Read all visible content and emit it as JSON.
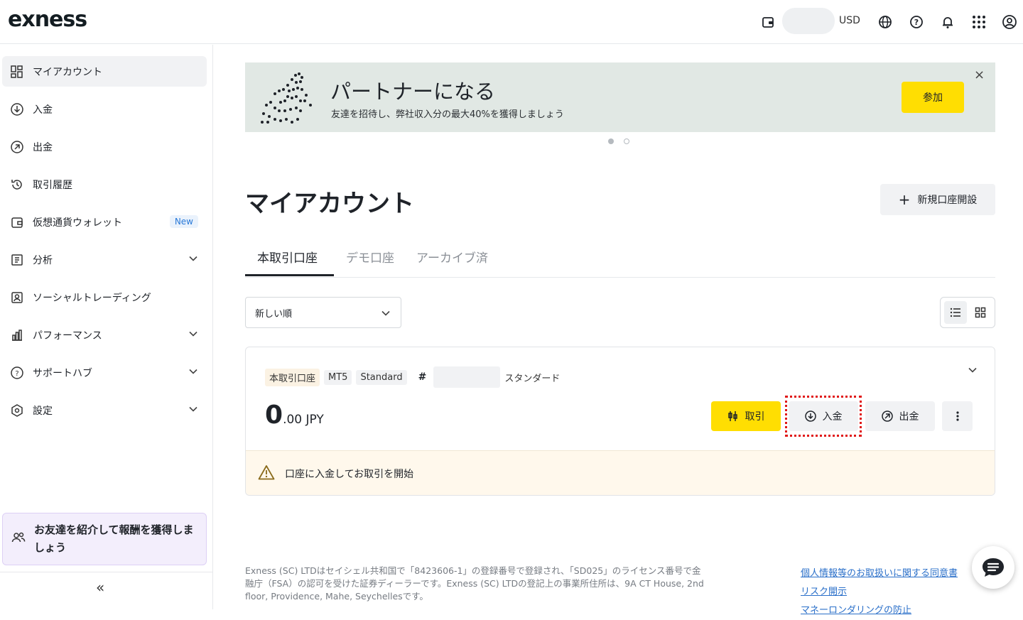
{
  "header": {
    "logo": "exness",
    "currency": "USD",
    "icons": [
      "wallet-icon",
      "globe-icon",
      "help-icon",
      "bell-icon",
      "apps-grid-icon",
      "profile-icon"
    ]
  },
  "sidebar": {
    "items": [
      {
        "label": "マイアカウント",
        "icon": "dashboard-icon",
        "active": true
      },
      {
        "label": "入金",
        "icon": "deposit-icon"
      },
      {
        "label": "出金",
        "icon": "withdraw-icon"
      },
      {
        "label": "取引履歴",
        "icon": "history-icon"
      },
      {
        "label": "仮想通貨ウォレット",
        "icon": "wallet-icon",
        "badge": "New"
      },
      {
        "label": "分析",
        "icon": "analytics-icon",
        "expandable": true
      },
      {
        "label": "ソーシャルトレーディング",
        "icon": "social-icon"
      },
      {
        "label": "パフォーマンス",
        "icon": "performance-icon",
        "expandable": true
      },
      {
        "label": "サポートハブ",
        "icon": "help-icon",
        "expandable": true
      },
      {
        "label": "設定",
        "icon": "settings-icon",
        "expandable": true
      }
    ],
    "promo": "お友達を紹介して報酬を獲得しましょう",
    "collapse": "«"
  },
  "banner": {
    "title": "パートナーになる",
    "subtitle": "友達を招待し、弊社収入分の最大40%を獲得しましょう",
    "button": "参加",
    "close": "×"
  },
  "main": {
    "title": "マイアカウント",
    "new_account": "新規口座開設",
    "tabs": [
      "本取引口座",
      "デモ口座",
      "アーカイブ済"
    ],
    "sort": "新しい順"
  },
  "account": {
    "tags": [
      "本取引口座",
      "MT5",
      "Standard"
    ],
    "hash": "#",
    "type": "スタンダード",
    "balance_int": "0",
    "balance_dec": ".00 JPY",
    "trade": "取引",
    "deposit": "入金",
    "withdraw": "出金",
    "warning": "口座に入金してお取引を開始"
  },
  "footer": {
    "text": "Exness (SC) LTDはセイシェル共和国で「8423606-1」の登録番号で登録され、「SD025」のライセンス番号で金融庁（FSA）の認可を受けた証券ディーラーです。Exness (SC) LTDの登記上の事業所住所は、9A CT House, 2nd floor, Providence, Mahe, Seychellesです。",
    "links": [
      "個人情報等のお取扱いに関する同意書",
      "リスク開示",
      "マネーロンダリングの防止"
    ]
  },
  "colors": {
    "accent": "#ffde02",
    "banner": "#e1e8e4",
    "highlight": "#e01818"
  }
}
